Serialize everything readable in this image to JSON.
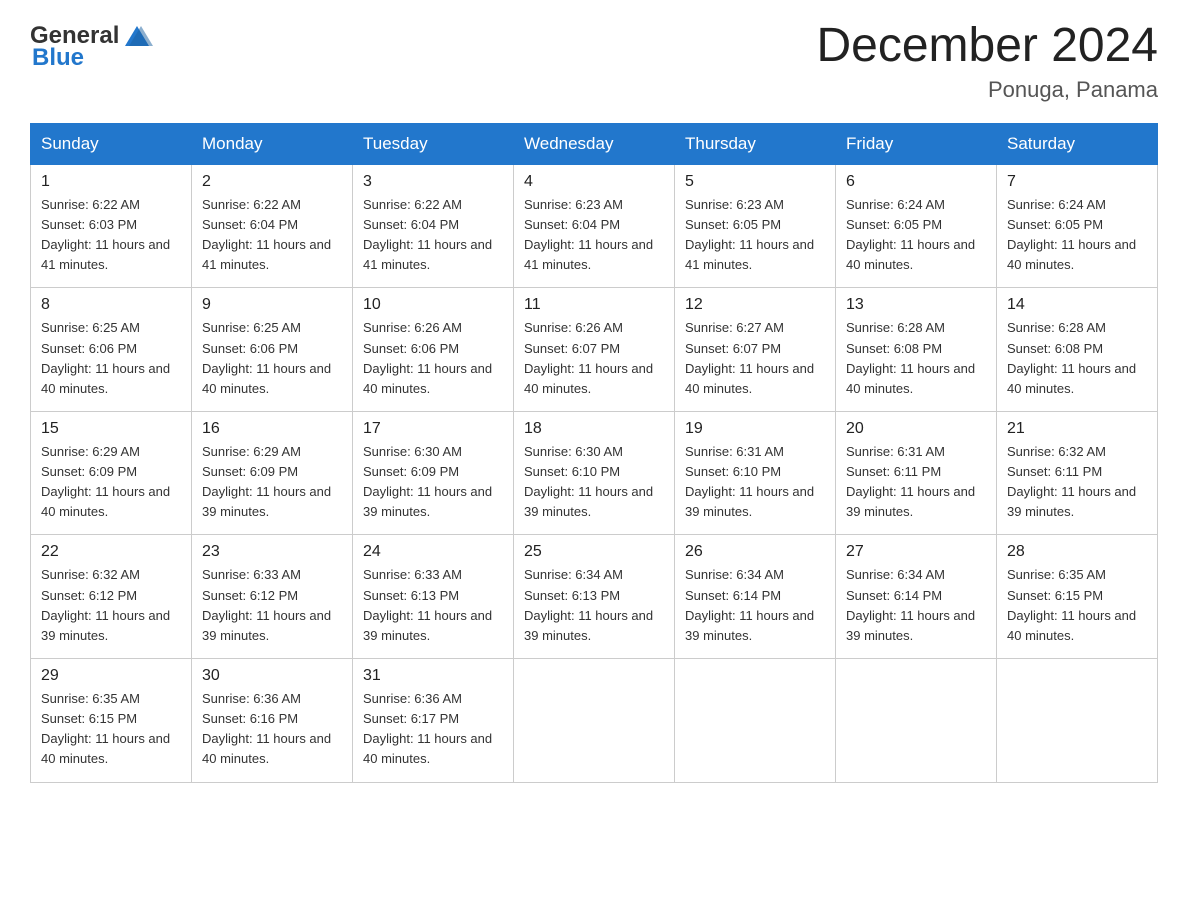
{
  "header": {
    "logo_general": "General",
    "logo_blue": "Blue",
    "title": "December 2024",
    "subtitle": "Ponuga, Panama"
  },
  "calendar": {
    "weekdays": [
      "Sunday",
      "Monday",
      "Tuesday",
      "Wednesday",
      "Thursday",
      "Friday",
      "Saturday"
    ],
    "weeks": [
      [
        {
          "day": "1",
          "sunrise": "6:22 AM",
          "sunset": "6:03 PM",
          "daylight": "11 hours and 41 minutes."
        },
        {
          "day": "2",
          "sunrise": "6:22 AM",
          "sunset": "6:04 PM",
          "daylight": "11 hours and 41 minutes."
        },
        {
          "day": "3",
          "sunrise": "6:22 AM",
          "sunset": "6:04 PM",
          "daylight": "11 hours and 41 minutes."
        },
        {
          "day": "4",
          "sunrise": "6:23 AM",
          "sunset": "6:04 PM",
          "daylight": "11 hours and 41 minutes."
        },
        {
          "day": "5",
          "sunrise": "6:23 AM",
          "sunset": "6:05 PM",
          "daylight": "11 hours and 41 minutes."
        },
        {
          "day": "6",
          "sunrise": "6:24 AM",
          "sunset": "6:05 PM",
          "daylight": "11 hours and 40 minutes."
        },
        {
          "day": "7",
          "sunrise": "6:24 AM",
          "sunset": "6:05 PM",
          "daylight": "11 hours and 40 minutes."
        }
      ],
      [
        {
          "day": "8",
          "sunrise": "6:25 AM",
          "sunset": "6:06 PM",
          "daylight": "11 hours and 40 minutes."
        },
        {
          "day": "9",
          "sunrise": "6:25 AM",
          "sunset": "6:06 PM",
          "daylight": "11 hours and 40 minutes."
        },
        {
          "day": "10",
          "sunrise": "6:26 AM",
          "sunset": "6:06 PM",
          "daylight": "11 hours and 40 minutes."
        },
        {
          "day": "11",
          "sunrise": "6:26 AM",
          "sunset": "6:07 PM",
          "daylight": "11 hours and 40 minutes."
        },
        {
          "day": "12",
          "sunrise": "6:27 AM",
          "sunset": "6:07 PM",
          "daylight": "11 hours and 40 minutes."
        },
        {
          "day": "13",
          "sunrise": "6:28 AM",
          "sunset": "6:08 PM",
          "daylight": "11 hours and 40 minutes."
        },
        {
          "day": "14",
          "sunrise": "6:28 AM",
          "sunset": "6:08 PM",
          "daylight": "11 hours and 40 minutes."
        }
      ],
      [
        {
          "day": "15",
          "sunrise": "6:29 AM",
          "sunset": "6:09 PM",
          "daylight": "11 hours and 40 minutes."
        },
        {
          "day": "16",
          "sunrise": "6:29 AM",
          "sunset": "6:09 PM",
          "daylight": "11 hours and 39 minutes."
        },
        {
          "day": "17",
          "sunrise": "6:30 AM",
          "sunset": "6:09 PM",
          "daylight": "11 hours and 39 minutes."
        },
        {
          "day": "18",
          "sunrise": "6:30 AM",
          "sunset": "6:10 PM",
          "daylight": "11 hours and 39 minutes."
        },
        {
          "day": "19",
          "sunrise": "6:31 AM",
          "sunset": "6:10 PM",
          "daylight": "11 hours and 39 minutes."
        },
        {
          "day": "20",
          "sunrise": "6:31 AM",
          "sunset": "6:11 PM",
          "daylight": "11 hours and 39 minutes."
        },
        {
          "day": "21",
          "sunrise": "6:32 AM",
          "sunset": "6:11 PM",
          "daylight": "11 hours and 39 minutes."
        }
      ],
      [
        {
          "day": "22",
          "sunrise": "6:32 AM",
          "sunset": "6:12 PM",
          "daylight": "11 hours and 39 minutes."
        },
        {
          "day": "23",
          "sunrise": "6:33 AM",
          "sunset": "6:12 PM",
          "daylight": "11 hours and 39 minutes."
        },
        {
          "day": "24",
          "sunrise": "6:33 AM",
          "sunset": "6:13 PM",
          "daylight": "11 hours and 39 minutes."
        },
        {
          "day": "25",
          "sunrise": "6:34 AM",
          "sunset": "6:13 PM",
          "daylight": "11 hours and 39 minutes."
        },
        {
          "day": "26",
          "sunrise": "6:34 AM",
          "sunset": "6:14 PM",
          "daylight": "11 hours and 39 minutes."
        },
        {
          "day": "27",
          "sunrise": "6:34 AM",
          "sunset": "6:14 PM",
          "daylight": "11 hours and 39 minutes."
        },
        {
          "day": "28",
          "sunrise": "6:35 AM",
          "sunset": "6:15 PM",
          "daylight": "11 hours and 40 minutes."
        }
      ],
      [
        {
          "day": "29",
          "sunrise": "6:35 AM",
          "sunset": "6:15 PM",
          "daylight": "11 hours and 40 minutes."
        },
        {
          "day": "30",
          "sunrise": "6:36 AM",
          "sunset": "6:16 PM",
          "daylight": "11 hours and 40 minutes."
        },
        {
          "day": "31",
          "sunrise": "6:36 AM",
          "sunset": "6:17 PM",
          "daylight": "11 hours and 40 minutes."
        },
        null,
        null,
        null,
        null
      ]
    ]
  }
}
